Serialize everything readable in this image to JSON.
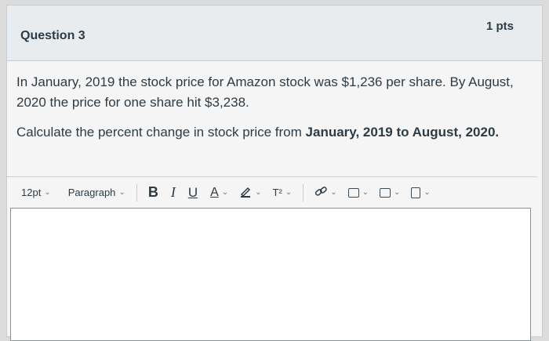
{
  "question": {
    "title": "Question 3",
    "points": "1 pts",
    "paragraph1": "In January, 2019 the stock price for Amazon stock was $1,236 per share. By August, 2020 the price for one share hit $3,238.",
    "paragraph2_plain": "Calculate the percent change in stock price from ",
    "paragraph2_bold": "January, 2019 to August, 2020."
  },
  "toolbar": {
    "font_size": "12pt",
    "block_format": "Paragraph",
    "bold": "B",
    "italic": "I",
    "underline": "U",
    "text_color": "A",
    "superscript": "T²"
  },
  "editor": {
    "value": ""
  }
}
